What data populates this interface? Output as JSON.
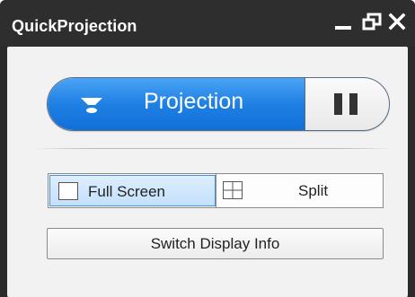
{
  "window": {
    "title": "QuickProjection"
  },
  "titlebar": {
    "minimize_icon": "minimize-icon",
    "restore_icon": "restore-icon",
    "close_icon": "close-icon"
  },
  "projection": {
    "label": "Projection",
    "icon": "projector-icon",
    "pause_icon": "pause-icon",
    "accent_color": "#1f80e3"
  },
  "mode": {
    "full_screen_label": "Full Screen",
    "split_label": "Split",
    "selected": "Full Screen"
  },
  "switch_display": {
    "label": "Switch Display Info"
  }
}
